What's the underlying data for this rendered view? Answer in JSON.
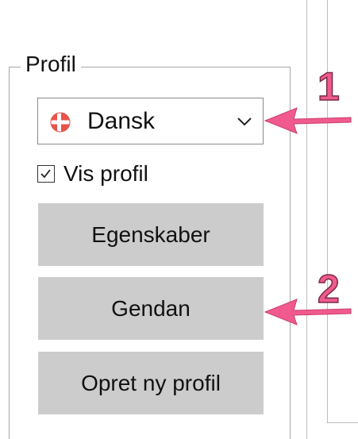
{
  "profile_group": {
    "title": "Profil",
    "language_dropdown": {
      "selected_value": "Dansk",
      "flag_icon": "denmark-flag-icon"
    },
    "show_profile_checkbox": {
      "label": "Vis profil",
      "checked": true
    },
    "buttons": {
      "properties_label": "Egenskaber",
      "restore_label": "Gendan",
      "new_profile_label": "Opret ny profil"
    }
  },
  "annotations": {
    "marker_1": "1",
    "marker_2": "2",
    "color": "#f05a8f"
  },
  "colors": {
    "button_bg": "#cccccc",
    "flag_red": "#e8534a"
  }
}
